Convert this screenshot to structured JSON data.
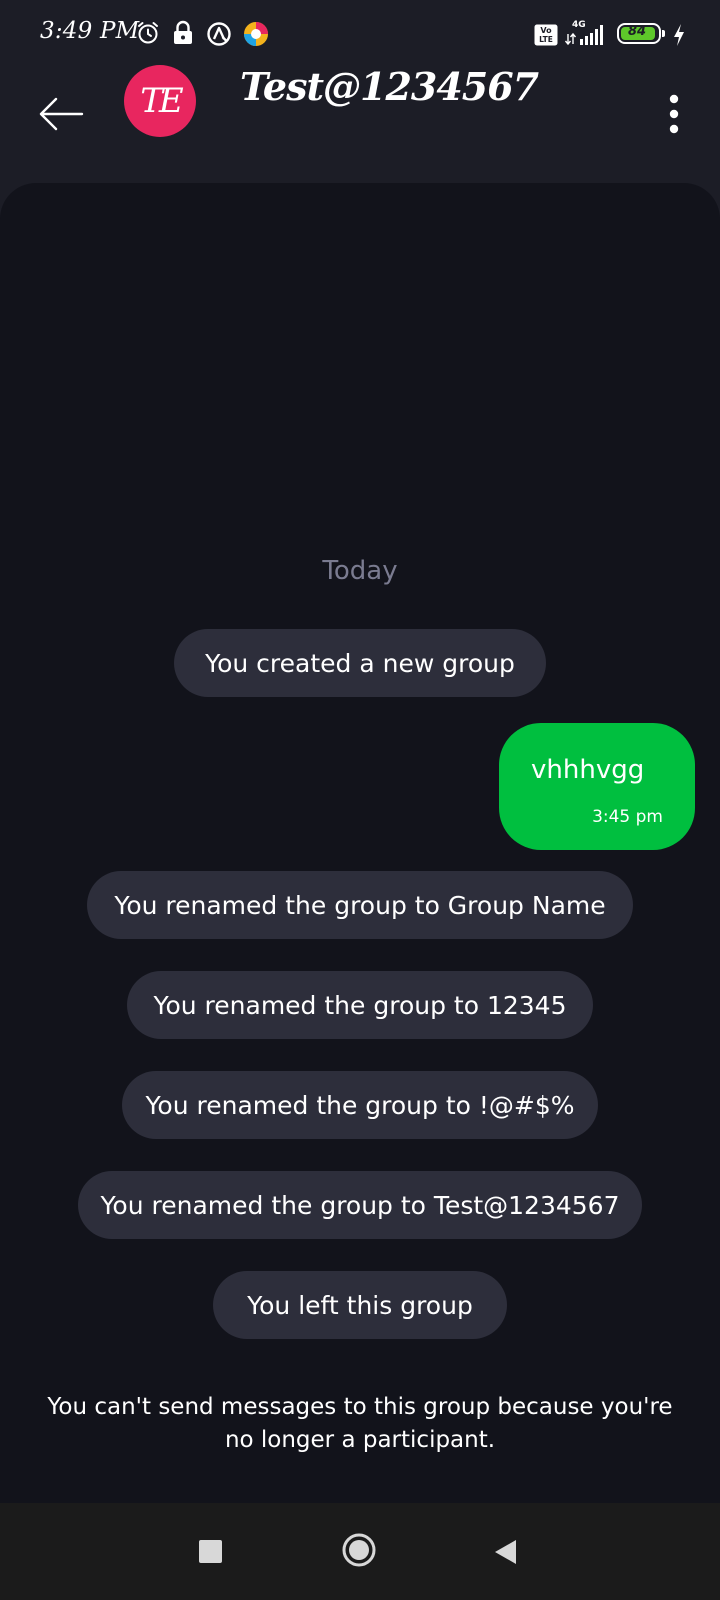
{
  "status_bar": {
    "time": "3:49 PM",
    "network": "4G",
    "volte": "Vo LTE",
    "battery": "84",
    "icons": [
      "alarm-icon",
      "lock-icon",
      "vpn-icon",
      "browser-app-icon",
      "volte-icon",
      "signal-icon",
      "battery-icon",
      "charging-icon"
    ]
  },
  "header": {
    "avatar_initials": "TE",
    "title": "Test@1234567",
    "back_icon": "arrow-left-icon",
    "menu_icon": "more-vertical-icon",
    "avatar_color": "#e8265f"
  },
  "chat": {
    "date_label": "Today",
    "system_messages": [
      "You created a new group",
      "You renamed the group to Group Name",
      "You renamed the group to 12345",
      "You renamed the group to !@#$%",
      "You renamed the group to Test@1234567",
      "You left this group"
    ],
    "outgoing_message": {
      "text": "vhhhvgg",
      "time": "3:45 pm",
      "color": "#00bf3f"
    },
    "notice": "You can't send messages to this group because you're no longer a participant."
  },
  "nav_bar": {
    "icons": [
      "recents-square-icon",
      "home-circle-icon",
      "back-triangle-icon"
    ]
  },
  "colors": {
    "background": "#12131b",
    "header": "#1c1d26",
    "pill": "#2d2e3b",
    "accent_green": "#00bf3f"
  }
}
